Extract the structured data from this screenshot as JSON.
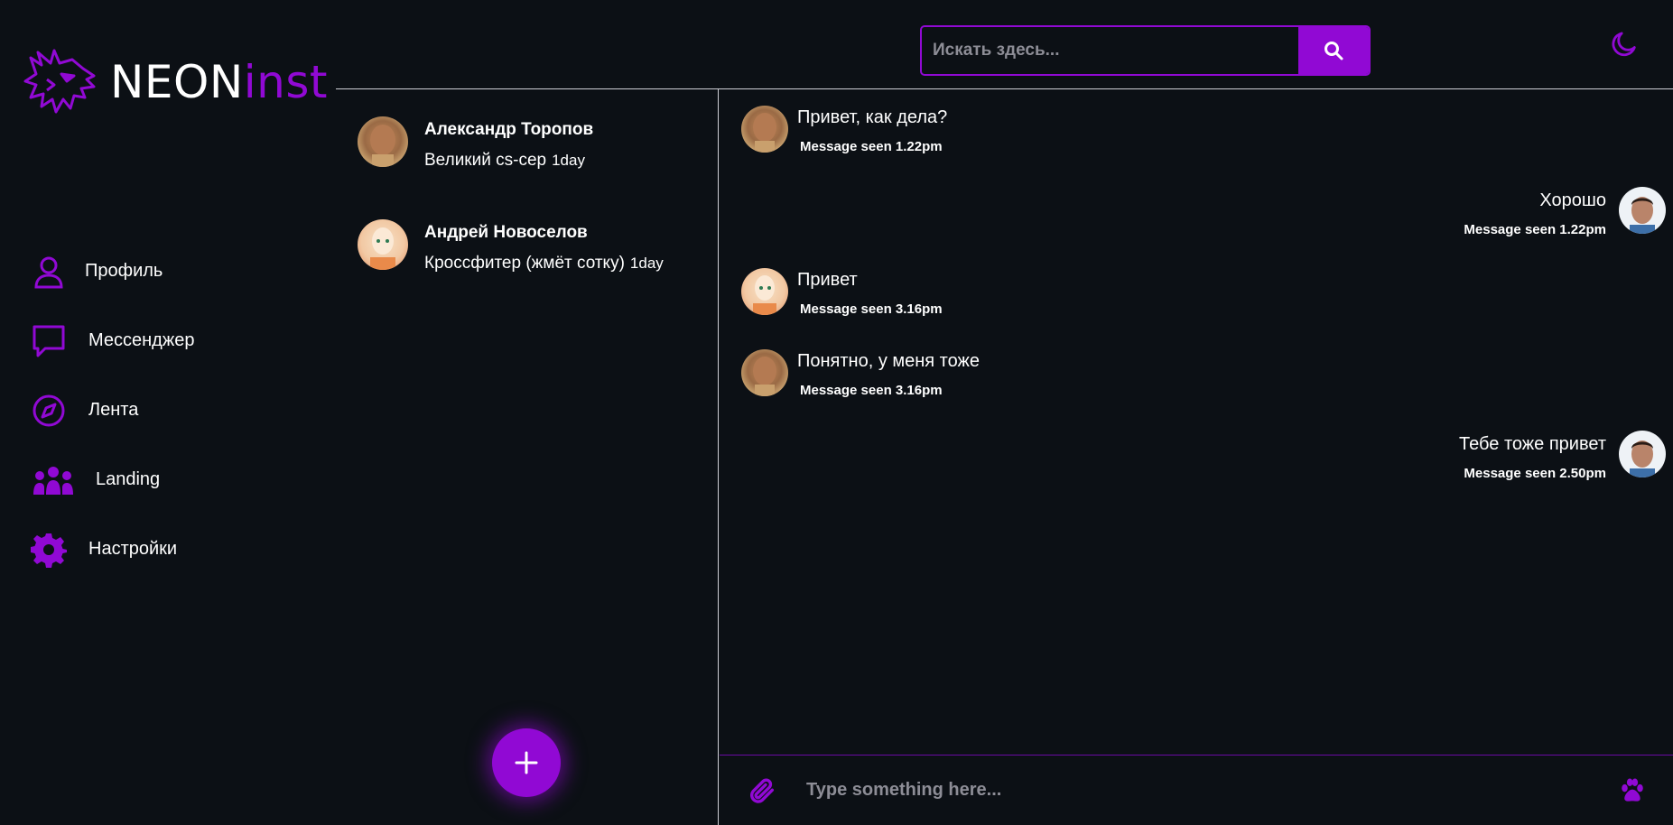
{
  "logo": {
    "part1": "NEON",
    "part2": "inst",
    "icon": "dragon-logo-icon"
  },
  "colors": {
    "accent": "#9109d4",
    "background": "#0c1015",
    "divider": "#cfcfd6"
  },
  "search": {
    "placeholder": "Искать здесь...",
    "icon": "search-icon"
  },
  "theme_toggle": {
    "icon": "moon-icon"
  },
  "nav": {
    "items": [
      {
        "label": "Профиль",
        "icon": "user-icon"
      },
      {
        "label": "Мессенджер",
        "icon": "chat-bubble-icon"
      },
      {
        "label": "Лента",
        "icon": "compass-icon"
      },
      {
        "label": "Landing",
        "icon": "users-group-icon"
      },
      {
        "label": "Настройки",
        "icon": "gear-icon"
      }
    ]
  },
  "contacts": [
    {
      "name": "Александр Торопов",
      "preview": "Великий cs-сер",
      "time": "1day"
    },
    {
      "name": "Андрей Новоселов",
      "preview": "Кроссфитер (жмёт сотку)",
      "time": "1day"
    }
  ],
  "fab": {
    "icon": "plus-icon"
  },
  "messages": [
    {
      "text": "Привет, как дела?",
      "seen": "Message seen 1.22pm",
      "side": "left"
    },
    {
      "text": "Хорошо",
      "seen": "Message seen 1.22pm",
      "side": "right"
    },
    {
      "text": "Привет",
      "seen": "Message seen 3.16pm",
      "side": "left"
    },
    {
      "text": "Понятно, у меня тоже",
      "seen": "Message seen 3.16pm",
      "side": "left"
    },
    {
      "text": "Тебе тоже привет",
      "seen": "Message seen 2.50pm",
      "side": "right"
    }
  ],
  "composer": {
    "placeholder": "Type something here...",
    "attach_icon": "paperclip-icon",
    "emoji_icon": "paw-icon"
  }
}
